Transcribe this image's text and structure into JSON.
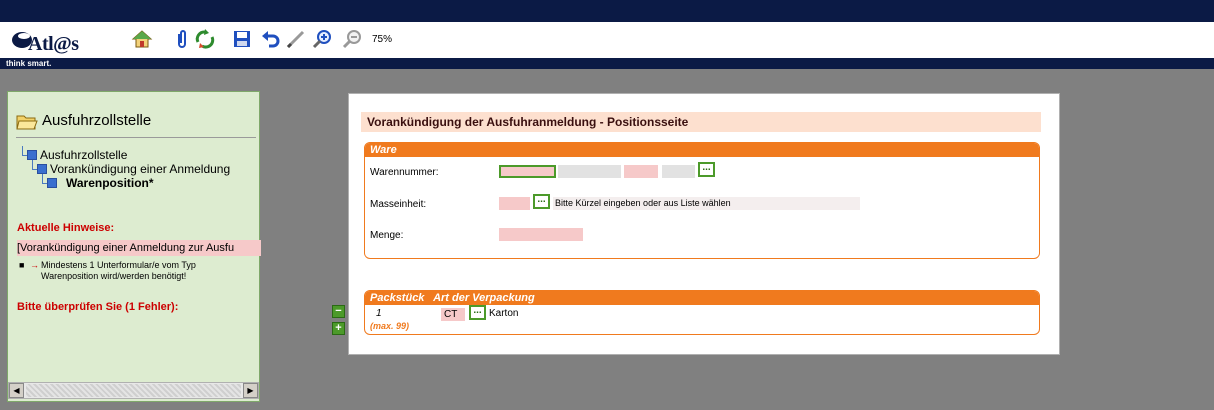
{
  "app": {
    "logo_text": "Atl@s",
    "tagline": "think smart."
  },
  "toolbar": {
    "icons": [
      "home-icon",
      "attachment-icon",
      "recycle-icon",
      "save-icon",
      "undo-icon",
      "pen-icon",
      "zoom-in-icon",
      "zoom-out-icon"
    ],
    "zoom_level": "75%"
  },
  "sidebar": {
    "heading": "Ausfuhrzollstelle",
    "tree": [
      {
        "label": "Ausfuhrzollstelle"
      },
      {
        "label": "Vorankündigung einer Anmeldung"
      },
      {
        "label": "Warenposition*"
      }
    ],
    "hints_title": "Aktuelle Hinweise:",
    "hint_line": "[Vorankündigung einer Anmeldung zur Ausfu",
    "hint_detail": "Mindestens 1 Unterformular/e vom Typ Warenposition wird/werden benötigt!",
    "check_title": "Bitte überprüfen Sie (1 Fehler):"
  },
  "document": {
    "title": "Vorankündigung der Ausfuhranmeldung - Positionsseite",
    "ware": {
      "section_title": "Ware",
      "warennummer_label": "Warennummer:",
      "masseinheit_label": "Masseinheit:",
      "masseinheit_hint": "Bitte Kürzel eingeben oder aus Liste wählen",
      "menge_label": "Menge:",
      "picker_label": "..."
    },
    "packstueck": {
      "col1": "Packstück",
      "col2": "Art der Verpackung",
      "row_number": "1",
      "code": "CT",
      "description": "Karton",
      "max_note": "(max. 99)"
    },
    "buttons": {
      "minus": "−",
      "plus": "+"
    }
  },
  "colors": {
    "navy": "#0b1a45",
    "orange": "#f07a1e",
    "panel_green": "#ddecd0",
    "error_red": "#cc0000"
  }
}
